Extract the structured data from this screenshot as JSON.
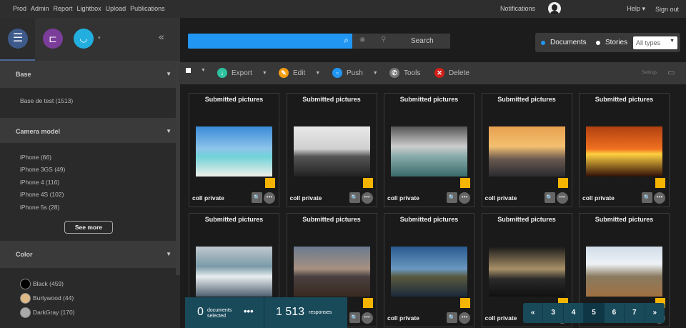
{
  "topnav": {
    "items": [
      "Prod",
      "Admin",
      "Report",
      "Lightbox",
      "Upload",
      "Publications"
    ],
    "notifications": "Notifications",
    "help": "Help",
    "signout": "Sign out"
  },
  "sidebar": {
    "sections": [
      {
        "title": "Base",
        "items": [
          "Base de test (1513)"
        ]
      },
      {
        "title": "Camera model",
        "items": [
          "iPhone (66)",
          "iPhone 3GS (49)",
          "iPhone 4 (116)",
          "iPhone 4S (102)",
          "iPhone 5s (28)"
        ],
        "see_more": "See more"
      },
      {
        "title": "Color",
        "items": [
          {
            "label": "Black (459)",
            "color": "#000000"
          },
          {
            "label": "Burlywood (44)",
            "color": "#deb887"
          },
          {
            "label": "DarkGray (170)",
            "color": "#a9a9a9"
          }
        ]
      }
    ]
  },
  "search": {
    "button": "Search",
    "accent": "#2196f3"
  },
  "filter": {
    "documents": "Documents",
    "stories": "Stories",
    "type": "All types"
  },
  "toolbar": {
    "export": "Export",
    "edit": "Edit",
    "push": "Push",
    "tools": "Tools",
    "delete": "Delete",
    "settings": "Settings"
  },
  "cards": [
    {
      "title": "Submitted pictures",
      "label": "coll private",
      "img": "linear-gradient(#3a8bd8,#8ec5ea 45%,#6fd3d8 60%,#f0eee8)"
    },
    {
      "title": "Submitted pictures",
      "label": "coll private",
      "img": "linear-gradient(#e8e8e8,#cfcfcf 45%,#555 60%,#222)"
    },
    {
      "title": "Submitted pictures",
      "label": "coll private",
      "img": "linear-gradient(#555,#ccc 40%,#8aa 60%,#3a6a6a)"
    },
    {
      "title": "Submitted pictures",
      "label": "coll private",
      "img": "linear-gradient(#e8a050,#f2c070 40%,#6a5a50 65%,#2a2a30)"
    },
    {
      "title": "Submitted pictures",
      "label": "coll private",
      "img": "linear-gradient(#b04010,#f07020 45%,#ffd040 55%,#301008)"
    },
    {
      "title": "Submitted pictures",
      "label": "coll private",
      "img": "linear-gradient(#c0c8d0,#7a9aa8 40%,#e8eef0 60%,#506070)"
    },
    {
      "title": "Submitted pictures",
      "label": "coll private",
      "img": "linear-gradient(#6a7a90,#a89080 45%,#4a4040 60%,#3a2a20)"
    },
    {
      "title": "Submitted pictures",
      "label": "coll private",
      "img": "linear-gradient(#2a5a90,#6a98c0 45%,#5a5a40 60%,#1a2a3a)"
    },
    {
      "title": "Submitted pictures",
      "label": "coll private",
      "img": "linear-gradient(#1a1a1a,#a89068 45%,#2a2a2a 65%,#101010)"
    },
    {
      "title": "Submitted pictures",
      "label": "coll private",
      "img": "linear-gradient(#d0dce8,#eef2f6 35%,#8a7a60 60%,#a07040)"
    }
  ],
  "selection": {
    "count": "0",
    "count_label1": "documents",
    "count_label2": "selected",
    "responses": "1 513",
    "responses_label": "responses"
  },
  "pager": {
    "first": "«",
    "pages": [
      "3",
      "4",
      "5",
      "6",
      "7"
    ],
    "current": "5",
    "last": "»"
  }
}
